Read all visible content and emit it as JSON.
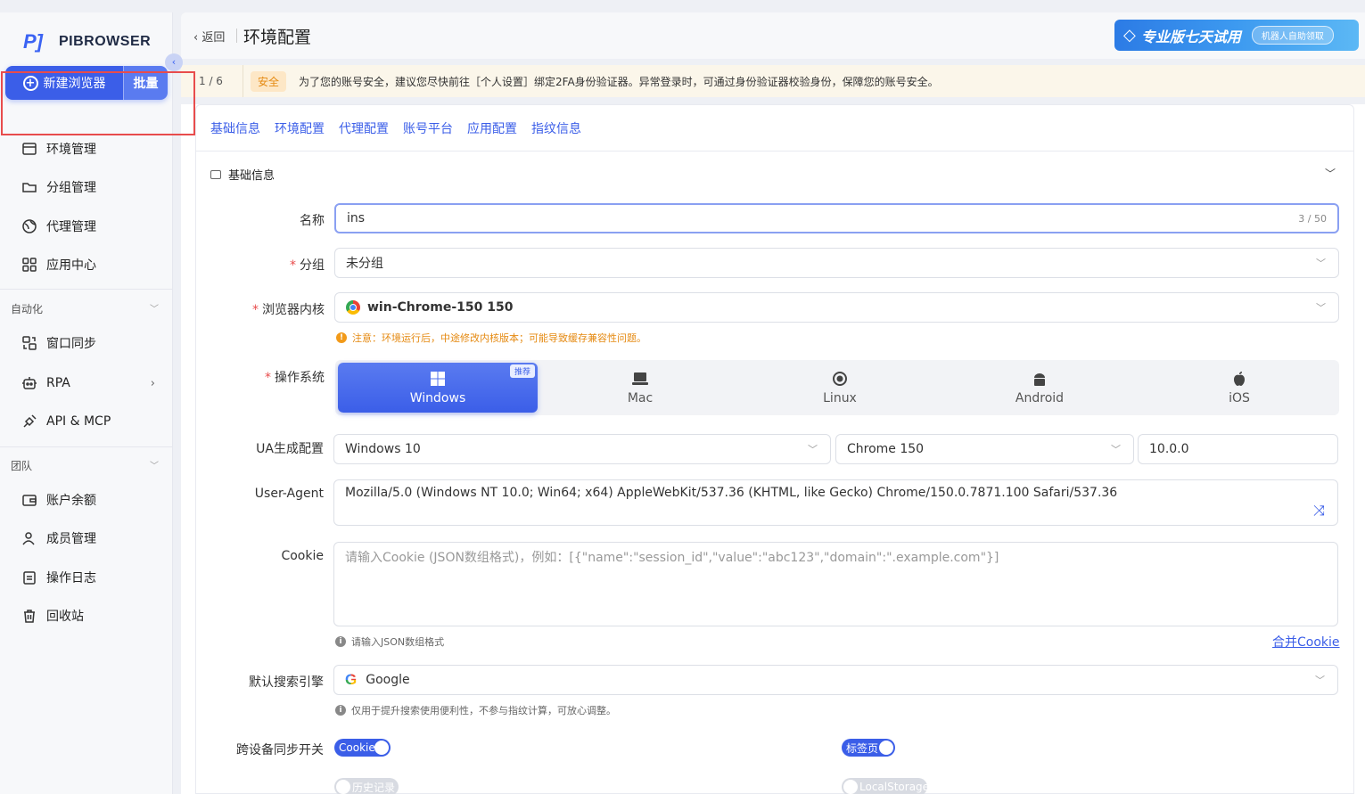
{
  "sidebar": {
    "logo_mark": "P]",
    "logo_text": "PIBROWSER",
    "collapse_icon": "‹",
    "new_browser": "新建浏览器",
    "batch": "批量",
    "items_top": [
      "环境管理",
      "分组管理",
      "代理管理",
      "应用中心"
    ],
    "section_automation": "自动化",
    "items_automation": [
      "窗口同步",
      "RPA",
      "API & MCP"
    ],
    "section_team": "团队",
    "items_team": [
      "账户余额",
      "成员管理",
      "操作日志",
      "回收站"
    ]
  },
  "header": {
    "back": "返回",
    "title": "环境配置",
    "pro_text": "专业版七天试用",
    "pro_pill": "机器人自助领取"
  },
  "notice": {
    "count": "1 / 6",
    "tag": "安全",
    "message": "为了您的账号安全，建议您尽快前往［个人设置］绑定2FA身份验证器。异常登录时，可通过身份验证器校验身份，保障您的账号安全。"
  },
  "tabs": [
    "基础信息",
    "环境配置",
    "代理配置",
    "账号平台",
    "应用配置",
    "指纹信息"
  ],
  "section_title": "基础信息",
  "form": {
    "name_label": "名称",
    "name_value": "ins",
    "name_count": "3 / 50",
    "group_label": "分组",
    "group_value": "未分组",
    "kernel_label": "浏览器内核",
    "kernel_value": "win-Chrome-150 150",
    "kernel_warn": "注意：环境运行后，中途修改内核版本；可能导致缓存兼容性问题。",
    "os_label": "操作系统",
    "os_options": [
      "Windows",
      "Mac",
      "Linux",
      "Android",
      "iOS"
    ],
    "os_recommend": "推荐",
    "ua_gen_label": "UA生成配置",
    "ua_os": "Windows 10",
    "ua_browser": "Chrome 150",
    "ua_version": "10.0.0",
    "ua_label": "User-Agent",
    "ua_value": "Mozilla/5.0 (Windows NT 10.0; Win64; x64) AppleWebKit/537.36 (KHTML, like Gecko) Chrome/150.0.7871.100 Safari/537.36",
    "cookie_label": "Cookie",
    "cookie_placeholder": "请输入Cookie (JSON数组格式)，例如：[{\"name\":\"session_id\",\"value\":\"abc123\",\"domain\":\".example.com\"}]",
    "cookie_hint": "请输入JSON数组格式",
    "merge_cookie": "合并Cookie",
    "search_label": "默认搜索引擎",
    "search_value": "Google",
    "search_hint": "仅用于提升搜索使用便利性，不参与指纹计算，可放心调整。",
    "sync_label": "跨设备同步开关",
    "toggle_cookie": "Cookie",
    "toggle_tabs": "标签页",
    "toggle_history": "历史记录",
    "toggle_localstorage": "LocalStorage"
  },
  "colors": {
    "accent": "#3b5ee8",
    "warn": "#e58a12",
    "highlight": "#e84c4c"
  }
}
